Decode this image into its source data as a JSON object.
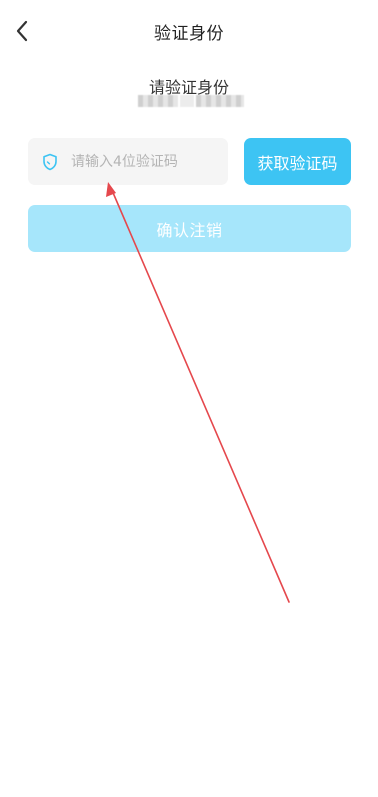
{
  "header": {
    "back_icon": "chevron-left-icon",
    "title": "验证身份"
  },
  "verify": {
    "title": "请验证身份",
    "phone_masked": true
  },
  "code_field": {
    "icon": "shield-icon",
    "placeholder": "请输入4位验证码",
    "value": ""
  },
  "get_code_button": {
    "label": "获取验证码"
  },
  "confirm_button": {
    "label": "确认注销"
  },
  "colors": {
    "accent": "#3dc4f3",
    "accent_disabled": "#a6e6fb",
    "input_bg": "#f5f5f5",
    "annotation": "#e5484d"
  }
}
